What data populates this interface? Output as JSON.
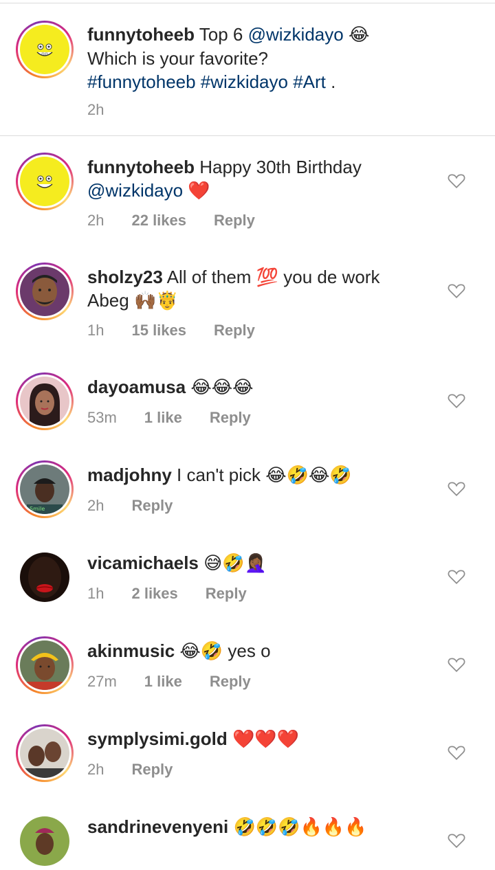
{
  "caption": {
    "username": "funnytoheeb",
    "text_1": "Top 6",
    "mention": "@wizkidayo",
    "emoji": "😂",
    "line_2": "Which is your favorite?",
    "hashtags": "#funnytoheeb #wizkidayo #Art",
    "tail": " .",
    "time": "2h"
  },
  "comments": [
    {
      "username": "funnytoheeb",
      "text": "Happy 30th Birthday",
      "mention": "@wizkidayo",
      "emojis": "❤️",
      "time": "2h",
      "likes": "22 likes",
      "reply": "Reply",
      "avatar": "spongebob-avatar",
      "ring": true
    },
    {
      "username": "sholzy23",
      "text": "All of them 💯 you de work Abeg 🙌🏾🤴",
      "time": "1h",
      "likes": "15 likes",
      "reply": "Reply",
      "avatar": "man-cartoon-avatar",
      "ring": true
    },
    {
      "username": "dayoamusa",
      "text": "😂😂😂",
      "time": "53m",
      "likes": "1 like",
      "reply": "Reply",
      "avatar": "woman-avatar",
      "ring": true
    },
    {
      "username": "madjohny",
      "text": "I can't pick 😂🤣😂🤣",
      "time": "2h",
      "likes": "",
      "reply": "Reply",
      "avatar": "man-cap-avatar",
      "ring": true
    },
    {
      "username": "vicamichaels",
      "text": "😅🤣🤦🏾‍♀️",
      "time": "1h",
      "likes": "2 likes",
      "reply": "Reply",
      "avatar": "red-lips-avatar",
      "ring": false
    },
    {
      "username": "akinmusic",
      "text": "😂🤣 yes o",
      "time": "27m",
      "likes": "1 like",
      "reply": "Reply",
      "avatar": "man-yellow-hat-avatar",
      "ring": true
    },
    {
      "username": "symplysimi.gold",
      "text": "❤️❤️❤️",
      "time": "2h",
      "likes": "",
      "reply": "Reply",
      "avatar": "couple-avatar",
      "ring": true
    },
    {
      "username": "sandrinevenyeni",
      "text": "🤣🤣🤣🔥🔥🔥",
      "avatar": "woman-outdoor-avatar",
      "ring": false
    }
  ],
  "colors": {
    "link": "#003569",
    "meta": "#8e8e8e",
    "text": "#262626"
  },
  "icons": {
    "like": "heart-outline-icon"
  }
}
